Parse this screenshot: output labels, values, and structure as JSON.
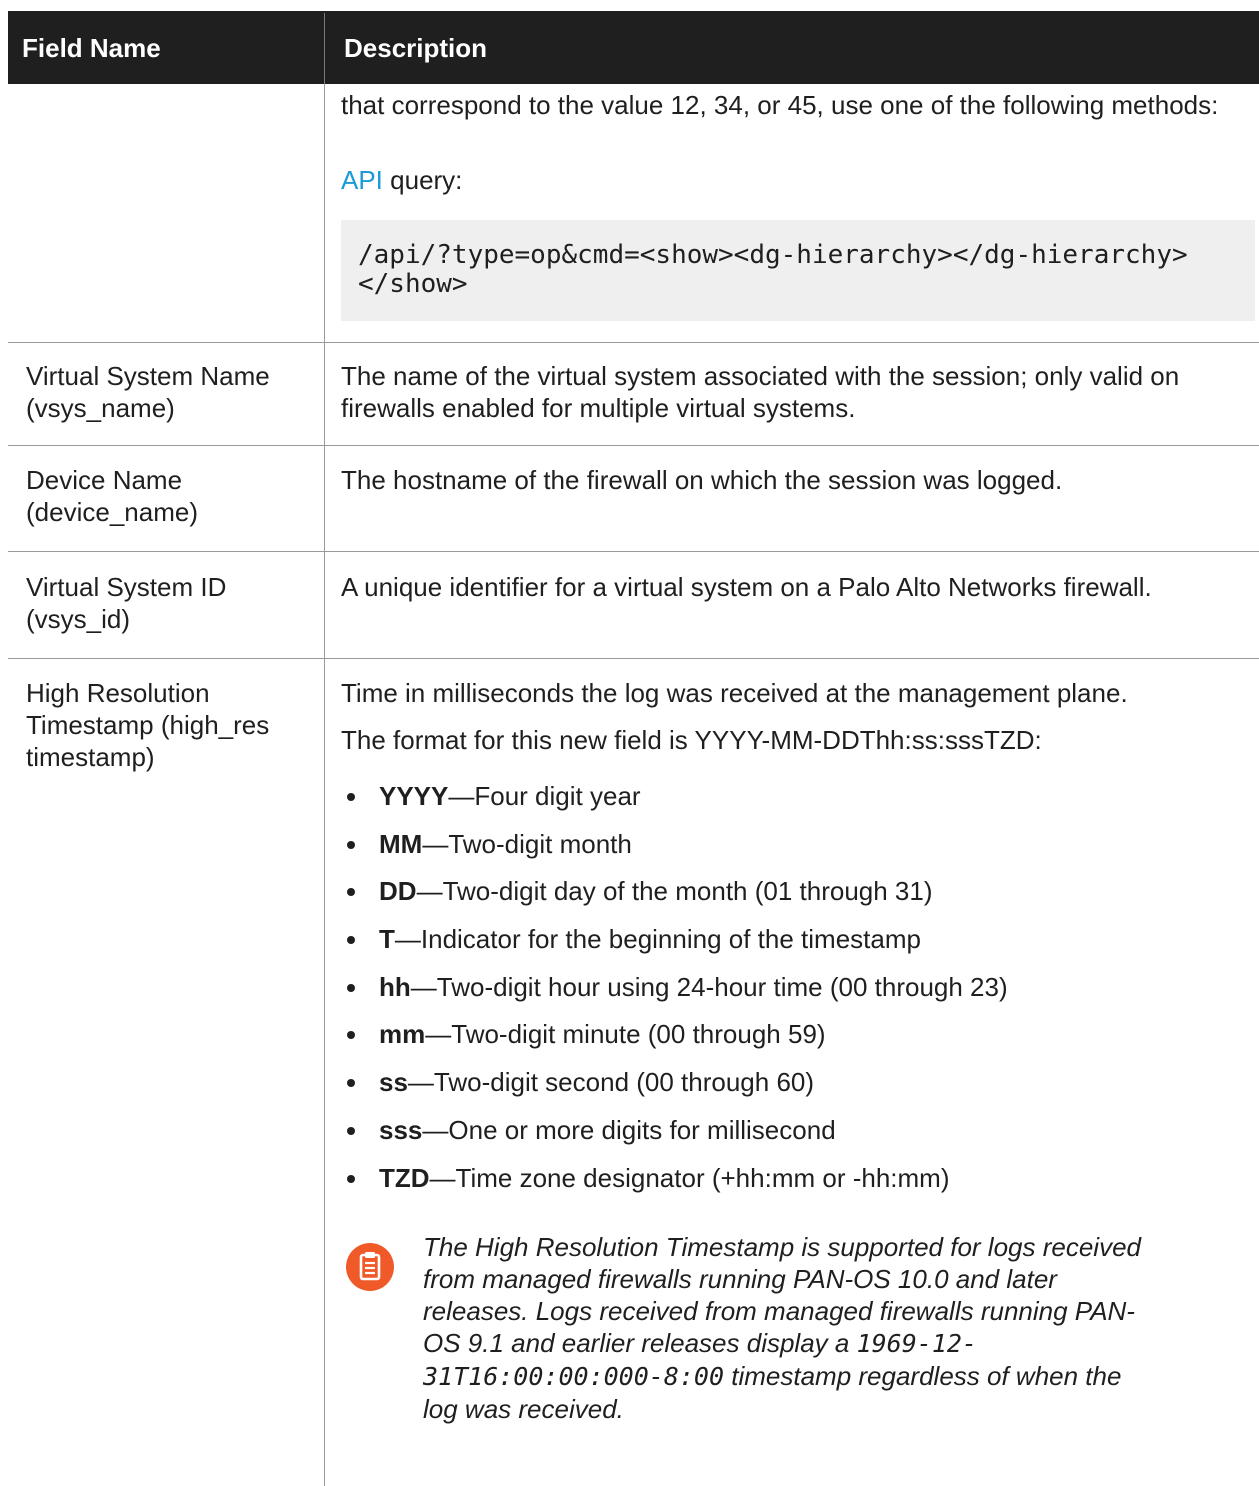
{
  "table": {
    "headers": [
      "Field Name",
      "Description"
    ],
    "continuation": {
      "text": "that correspond to the value 12, 34, or 45, use one of the following methods:",
      "api_link": "API",
      "api_suffix": " query:",
      "code": "/api/?type=op&cmd=<show><dg-hierarchy></dg-hierarchy></show>"
    },
    "rows": [
      {
        "field": "Virtual System Name (vsys_name)",
        "description": "The name of the virtual system associated with the session; only valid on firewalls enabled for multiple virtual systems."
      },
      {
        "field": "Device Name (device_name)",
        "description": "The hostname of the firewall on which the session was logged."
      },
      {
        "field": "Virtual System ID (vsys_id)",
        "description": "A unique identifier for a virtual system on a Palo Alto Networks firewall."
      },
      {
        "field": "High Resolution Timestamp (high_res timestamp)",
        "description": "Time in milliseconds the log was received at the management plane.",
        "format_intro": "The format for this new field is YYYY-MM-DDThh:ss:sssTZD:",
        "bullets": [
          {
            "term": "YYYY",
            "text": "—Four digit year"
          },
          {
            "term": "MM",
            "text": "—Two-digit month"
          },
          {
            "term": "DD",
            "text": "—Two-digit day of the month (01 through 31)"
          },
          {
            "term": "T",
            "text": "—Indicator for the beginning of the timestamp"
          },
          {
            "term": "hh",
            "text": "—Two-digit hour using 24-hour time (00 through 23)"
          },
          {
            "term": "mm",
            "text": "—Two-digit minute (00 through 59)"
          },
          {
            "term": "ss",
            "text": "—Two-digit second (00 through 60)"
          },
          {
            "term": "sss",
            "text": "—One or more digits for millisecond"
          },
          {
            "term": "TZD",
            "text": "—Time zone designator (+hh:mm or -hh:mm)"
          }
        ],
        "note": {
          "icon": "note-icon",
          "before": "The High Resolution Timestamp is supported for logs received from managed firewalls running PAN-OS 10.0 and later releases. Logs received from managed firewalls running PAN-OS 9.1 and earlier releases display a ",
          "code": "1969-12-31T16:00:00:000-8:00",
          "after": " timestamp regardless of when the log was received."
        }
      }
    ]
  },
  "colors": {
    "header_bg": "#1f1f1f",
    "link": "#1a9bd7",
    "note_icon": "#f05a28",
    "code_bg": "#efefef"
  }
}
